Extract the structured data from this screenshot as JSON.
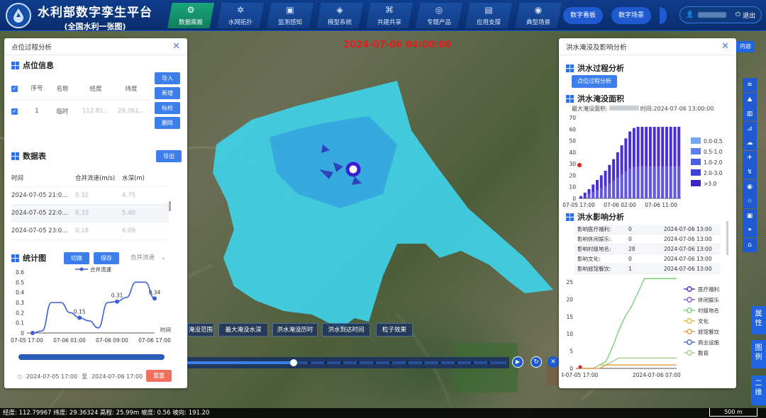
{
  "app": {
    "title": "水利部数字孪生平台",
    "subtitle": "(全国水利一张图)"
  },
  "nav": [
    {
      "label": "数据底板",
      "icon": "data-base-icon",
      "glyph": "⚙"
    },
    {
      "label": "水网拓扑",
      "icon": "network-icon",
      "glyph": "✲"
    },
    {
      "label": "监测感知",
      "icon": "monitor-icon",
      "glyph": "▣"
    },
    {
      "label": "模型系统",
      "icon": "cube-icon",
      "glyph": "◈"
    },
    {
      "label": "共建共享",
      "icon": "share-icon",
      "glyph": "⌘"
    },
    {
      "label": "专题产品",
      "icon": "compass-icon",
      "glyph": "◎"
    },
    {
      "label": "应用支撑",
      "icon": "screen-icon",
      "glyph": "▤"
    },
    {
      "label": "典型场景",
      "icon": "globe-icon",
      "glyph": "◉"
    }
  ],
  "topbar": {
    "btn1": "数字看板",
    "btn2": "数字场景",
    "logout": "退出"
  },
  "map": {
    "time": "2024-07-06 04:00:00",
    "scale": "500 m",
    "buttons": [
      "淹没范围",
      "最大淹没水深",
      "洪水淹没历时",
      "洪水到达时间",
      "粒子效果"
    ],
    "peek": "内容"
  },
  "status": {
    "text": "经度: 112.79967  纬度: 29.36324  高程: 25.99m  坡度: 0.56  坡向: 191.20"
  },
  "left": {
    "title": "点位过程分析",
    "info_title": "点位信息",
    "cols": [
      "序号",
      "名称",
      "经度",
      "纬度"
    ],
    "row": {
      "idx": "1",
      "name": "临时",
      "lon": "112.81…",
      "lat": "29.361…"
    },
    "btns": [
      "导入",
      "新增",
      "标检",
      "删除"
    ],
    "table_title": "数据表",
    "export": "导出",
    "tcols": [
      "时间",
      "合并流速(m/s)",
      "水深(m)"
    ],
    "trows": [
      {
        "t": "2024-07-05 21:0…",
        "v": "0.32",
        "d": "4.75"
      },
      {
        "t": "2024-07-05 22:0…",
        "v": "0.33",
        "d": "5.40"
      },
      {
        "t": "2024-07-05 23:0…",
        "v": "0.18",
        "d": "6.09"
      }
    ],
    "chart_title": "统计图",
    "switch": "切换",
    "save": "保存",
    "select": "合并流速",
    "legend": "合并流速",
    "yaxis": [
      "0",
      "0.1",
      "0.2",
      "0.3",
      "0.4",
      "0.5",
      "0.6"
    ],
    "xaxis": [
      "07-05 17:00",
      "07-06 01:00",
      "07-06 09:00",
      "07-06 17:00"
    ],
    "xunit": "时间",
    "start": "2024-07-05 17:00",
    "to": "至",
    "end": "2024-07-06 17:00",
    "reset": "重置"
  },
  "right": {
    "title": "洪水淹没及影响分析",
    "s1": "洪水过程分析",
    "s1btn": "点位过程分析",
    "s2": "洪水淹没面积",
    "max_label": "最大淹没面积:",
    "max_time": "时间:2024-07-06 13:00:00",
    "bar_y": [
      "0",
      "10",
      "20",
      "30",
      "40",
      "50",
      "60",
      "70"
    ],
    "bar_x": [
      "07-05 17:00",
      "07-06 02:00",
      "07-06 11:00"
    ],
    "bar_legend": [
      "0.0-0.5",
      "0.5-1.0",
      "1.0-2.0",
      "2.0-3.0",
      ">3.0"
    ],
    "s3": "洪水影响分析",
    "impact": [
      {
        "k": "影响医疗福利:",
        "v": "0",
        "t": "2024-07-06 13:00"
      },
      {
        "k": "影响休闲娱乐:",
        "v": "0",
        "t": "2024-07-06 13:00"
      },
      {
        "k": "影响村级地名:",
        "v": "28",
        "t": "2024-07-06 13:00"
      },
      {
        "k": "影响文化:",
        "v": "0",
        "t": "2024-07-06 13:00"
      },
      {
        "k": "影响旅馆餐饮:",
        "v": "1",
        "t": "2024-07-06 13:00"
      }
    ],
    "line_y": [
      "0",
      "5",
      "10",
      "15",
      "20",
      "25"
    ],
    "line_x": [
      "'4-07-05 17:00",
      "2024-07-06 07:00"
    ],
    "line_legend": [
      "医疗福利",
      "休闲娱乐",
      "村级地名",
      "文化",
      "旅馆餐饮",
      "商业设施",
      "教育"
    ]
  },
  "side_tabs": [
    "属性",
    "图例",
    "二维"
  ],
  "colors": {
    "accent": "#3c7fea",
    "water": "#3fd3e8",
    "bar": "#4a2fd6",
    "active_nav": "#1aa57a"
  },
  "chart_data": [
    {
      "type": "line",
      "title": "统计图",
      "series": [
        {
          "name": "合并流速",
          "x": [
            "07-05 17:00",
            "07-05 18:00",
            "07-05 19:00",
            "07-05 21:00",
            "07-05 23:00",
            "07-06 01:00",
            "07-06 03:00",
            "07-06 05:00",
            "07-06 07:00",
            "07-06 09:00",
            "07-06 11:00",
            "07-06 13:00",
            "07-06 15:00",
            "07-06 17:00"
          ],
          "values": [
            0,
            0.02,
            0.3,
            0.3,
            0.2,
            0.15,
            0.12,
            0.05,
            0.3,
            0.31,
            0.35,
            0.5,
            0.5,
            0.34
          ]
        }
      ],
      "xlabel": "时间",
      "ylim": [
        0,
        0.6
      ],
      "data_labels": [
        "0.15",
        "0.31",
        "0.34"
      ]
    },
    {
      "type": "bar",
      "title": "洪水淹没面积",
      "categories_range": [
        "07-05 17:00",
        "07-06 17:00"
      ],
      "values": [
        2,
        5,
        8,
        12,
        16,
        20,
        24,
        29,
        34,
        40,
        46,
        52,
        58,
        61,
        62,
        62,
        62,
        62,
        62,
        62,
        62,
        62,
        62,
        62,
        62
      ],
      "series_legend": [
        "0.0-0.5",
        "0.5-1.0",
        "1.0-2.0",
        "2.0-3.0",
        ">3.0"
      ],
      "ylim": [
        0,
        70
      ]
    },
    {
      "type": "line",
      "title": "洪水影响分析",
      "series": [
        {
          "name": "村级地名",
          "values": [
            0,
            0,
            0,
            1,
            2,
            6,
            11,
            15,
            18,
            22,
            26,
            27,
            28,
            28,
            28,
            28
          ]
        },
        {
          "name": "教育",
          "values": [
            0,
            0,
            0,
            1,
            1,
            2,
            3,
            3,
            3,
            3,
            3,
            3,
            3,
            3,
            3,
            3
          ]
        },
        {
          "name": "旅馆餐饮",
          "values": [
            0,
            0,
            0,
            0,
            1,
            1,
            1,
            1,
            1,
            1,
            1,
            1,
            1,
            1,
            1,
            1
          ]
        }
      ],
      "ylim": [
        0,
        25
      ]
    }
  ]
}
